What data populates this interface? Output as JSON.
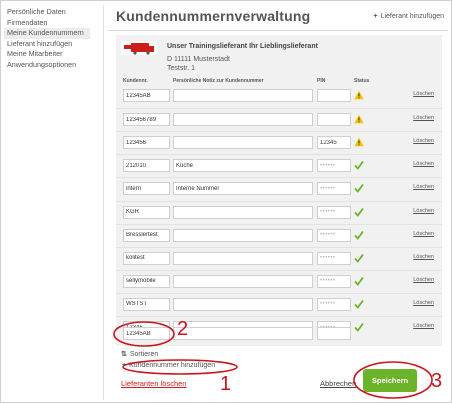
{
  "sidebar": {
    "items": [
      {
        "label": "Persönliche Daten",
        "active": false
      },
      {
        "label": "Firmendaten",
        "active": false
      },
      {
        "label": "Meine Kundennummern",
        "active": true
      },
      {
        "label": "Lieferant hinzufügen",
        "active": false
      },
      {
        "label": "Meine Mitarbeiter",
        "active": false
      },
      {
        "label": "Anwendungsoptionen",
        "active": false
      }
    ]
  },
  "header": {
    "title": "Kundennummernverwaltung",
    "add_supplier": "Lieferant hinzufügen"
  },
  "supplier": {
    "name": "Unser Trainingslieferant Ihr Lieblingslieferant",
    "address_line1": "D 11111 Musterstadt",
    "address_line2": "Teststr. 1"
  },
  "table": {
    "columns": {
      "customer_number": "Kundennr.",
      "note": "Persönliche Notiz zur Kundennummer",
      "pin": "PIN",
      "status": "Status"
    },
    "delete_label": "Löschen",
    "rows": [
      {
        "kn": "12345AB",
        "note": "",
        "pin": "",
        "status": "warning"
      },
      {
        "kn": "123456789",
        "note": "",
        "pin": "",
        "status": "warning"
      },
      {
        "kn": "123456",
        "note": "",
        "pin": "12345",
        "status": "warning"
      },
      {
        "kn": "212010",
        "note": "Küche",
        "pin": "••••••",
        "status": "ok"
      },
      {
        "kn": "intern",
        "note": "Interne Nummer",
        "pin": "••••••",
        "status": "ok"
      },
      {
        "kn": "KGR",
        "note": "",
        "pin": "••••••",
        "status": "ok"
      },
      {
        "kn": "Bresslertest",
        "note": "",
        "pin": "••••••",
        "status": "ok"
      },
      {
        "kn": "kolitest",
        "note": "",
        "pin": "••••••",
        "status": "ok"
      },
      {
        "kn": "sellymobile",
        "note": "",
        "pin": "••••••",
        "status": "ok"
      },
      {
        "kn": "WSTST",
        "note": "",
        "pin": "••••••",
        "status": "ok"
      },
      {
        "kn": "12345",
        "note": "",
        "pin": "••••••",
        "status": "ok"
      }
    ],
    "new_row": {
      "kn": "12345AB",
      "note": "",
      "pin": ""
    }
  },
  "actions": {
    "sort": "Sortieren",
    "add_customer_number": "Kundennummer hinzufügen",
    "delete_supplier": "Lieferanten löschen",
    "cancel": "Abbrechen",
    "save": "Speichern"
  },
  "annotations": {
    "one": "1",
    "two": "2",
    "three": "3"
  },
  "colors": {
    "accent_green": "#6bb329",
    "annotation_red": "#c8161d",
    "warning_yellow": "#f2c200",
    "danger_red": "#d0201b"
  }
}
